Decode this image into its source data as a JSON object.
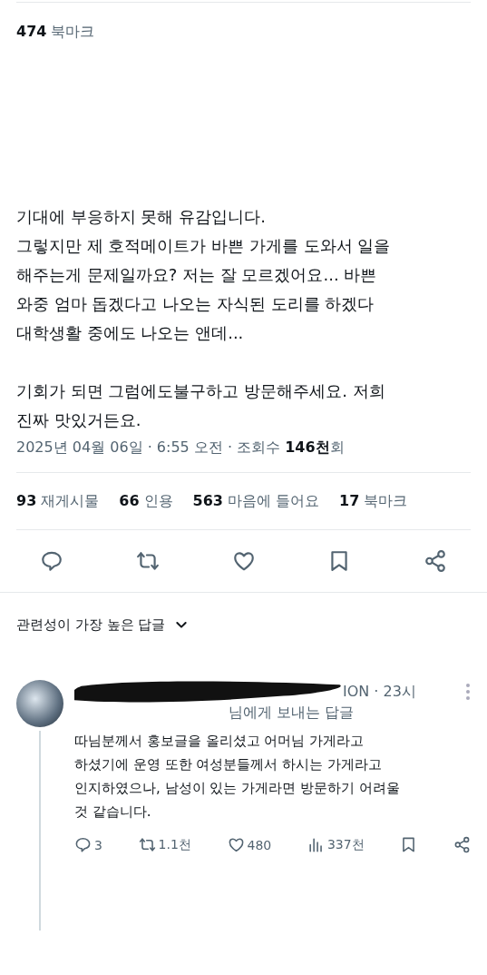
{
  "top_stat": {
    "count": "474",
    "label": "북마크"
  },
  "tweet": {
    "text": "기대에 부응하지 못해 유감입니다.\n그렇지만 제 호적메이트가 바쁜 가게를 도와서 일을\n해주는게 문제일까요? 저는 잘 모르겠어요... 바쁜\n와중 엄마 돕겠다고 나오는 자식된 도리를 하겠다\n대학생활 중에도 나오는 앤데...\n\n기회가 되면 그럼에도불구하고 방문해주세요. 저희\n진짜 맛있거든요.",
    "meta": "2025년 04월 06일 · 6:55 오전 · 조회수 **146천**회"
  },
  "stats": [
    {
      "count": "93",
      "label": "재게시물"
    },
    {
      "count": "66",
      "label": "인용"
    },
    {
      "count": "563",
      "label": "마음에 들어요"
    },
    {
      "count": "17",
      "label": "북마크"
    }
  ],
  "actions": [
    {
      "kind": "reply"
    },
    {
      "kind": "repost"
    },
    {
      "kind": "like"
    },
    {
      "kind": "bookmark"
    },
    {
      "kind": "share"
    }
  ],
  "sort": {
    "label": "관련성이 가장 높은 답글"
  },
  "reply": {
    "author_tail": "ION · 23시",
    "replying_to": "님에게 보내는 답글",
    "text": "따님분께서 홍보글을 올리셨고 어머님 가게라고\n하셨기에 운영 또한 여성분들께서 하시는 가게라고\n인지하였으나, 남성이 있는 가게라면 방문하기 어려울\n것 같습니다.",
    "actions": [
      {
        "kind": "reply",
        "count": "3"
      },
      {
        "kind": "repost",
        "count": "1.1천"
      },
      {
        "kind": "like",
        "count": "480"
      },
      {
        "kind": "views",
        "count": "337천"
      },
      {
        "kind": "bookmark"
      },
      {
        "kind": "share"
      }
    ]
  }
}
